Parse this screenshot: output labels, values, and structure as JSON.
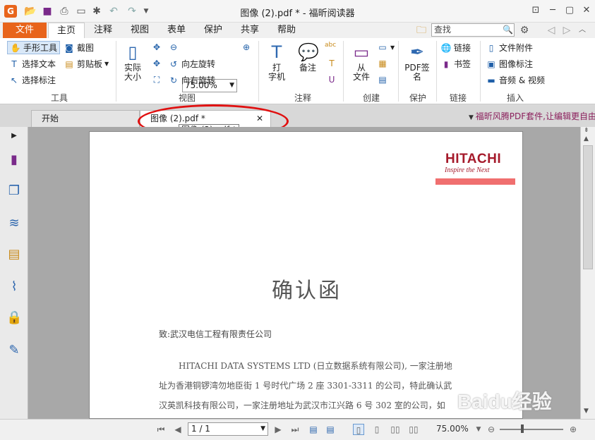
{
  "window": {
    "title": "图像 (2).pdf * - 福昕阅读器",
    "minimize": "─",
    "restore": "▢",
    "close": "✕",
    "settings": "⚙"
  },
  "quick_access": [
    "open-icon",
    "save-icon",
    "print-icon",
    "scan-icon",
    "new-icon",
    "undo-icon",
    "redo-icon",
    "dropdown-icon"
  ],
  "ribbon_tabs": {
    "file": "文件",
    "home": "主页",
    "comment": "注释",
    "view": "视图",
    "form": "表单",
    "protect": "保护",
    "share": "共享",
    "help": "帮助"
  },
  "search": {
    "placeholder": "查找"
  },
  "tools": {
    "hand": "手形工具",
    "select_text": "选择文本",
    "select_annot": "选择标注",
    "screenshot": "截图",
    "clipboard": "剪贴板",
    "label": "工具"
  },
  "view_group": {
    "actual_size_l1": "实际",
    "actual_size_l2": "大小",
    "zoom": "75.00%",
    "rotate_left": "向左旋转",
    "rotate_right": "向右旋转",
    "label": "视图"
  },
  "comment_group": {
    "typewriter_l1": "打",
    "typewriter_l2": "字机",
    "note": "备注",
    "label": "注释"
  },
  "create_group": {
    "from_file_l1": "从",
    "from_file_l2": "文件",
    "label": "创建"
  },
  "protect_group": {
    "sign_l1": "PDF签",
    "sign_l2": "名",
    "label": "保护"
  },
  "link_group": {
    "link": "链接",
    "bookmark": "书签",
    "label": "链接"
  },
  "insert_group": {
    "attach": "文件附件",
    "image": "图像标注",
    "media": "音频 & 视频",
    "label": "插入"
  },
  "doc_tabs": {
    "start": "开始",
    "current": "图像 (2).pdf *",
    "tooltip": "图像 (2).pdf *"
  },
  "promo": "福昕风腾PDF套件,让编辑更自由",
  "document": {
    "brand": "HITACHI",
    "tagline": "Inspire the Next",
    "title": "确认函",
    "to": "致:武汉电信工程有限责任公司",
    "p1": "HITACHI DATA SYSTEMS LTD (日立数据系统有限公司), 一家注册地",
    "p2": "址为香港铜锣湾勿地臣街 1 号时代广场 2 座 3301-3311 的公司，特此确认武",
    "p3": "汉英凯科技有限公司，一家注册地址为武汉市江兴路 6 号 302 室的公司，如"
  },
  "status": {
    "page": "1 / 1",
    "zoom": "75.00%"
  },
  "watermark": "Baidu经验",
  "colors": {
    "accent": "#e8641b",
    "brand": "#a51a2b",
    "annotation": "#e01010"
  }
}
